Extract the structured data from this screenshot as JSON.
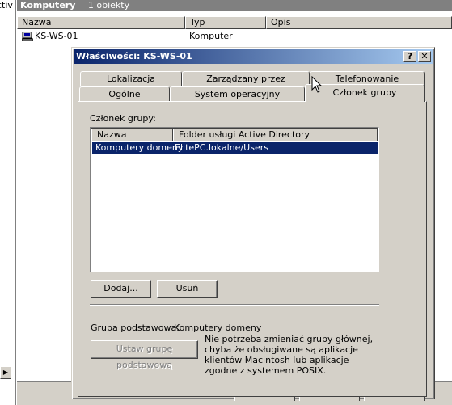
{
  "background": {
    "left_strip_text": "ctiv",
    "pane_title": "Komputery",
    "pane_count": "1 obiekty",
    "columns": [
      "Nazwa",
      "Typ",
      "Opis"
    ],
    "rows": [
      {
        "name": "KS-WS-01",
        "type": "Komputer",
        "icon": "computer-icon"
      }
    ],
    "scroll_arrow": "▶"
  },
  "dialog": {
    "title": "Właściwości: KS-WS-01",
    "help_glyph": "?",
    "close_glyph": "✕",
    "tabs_row1": [
      "Lokalizacja",
      "Zarządzany przez",
      "Telefonowanie"
    ],
    "tabs_row2": [
      "Ogólne",
      "System operacyjny",
      "Członek grupy"
    ],
    "active_tab": "Członek grupy",
    "member_label": "Członek grupy:",
    "list_columns": [
      "Nazwa",
      "Folder usługi Active Directory"
    ],
    "members": [
      {
        "name": "Komputery domeny",
        "folder": "ElitePC.lokalne/Users",
        "selected": true
      }
    ],
    "add_button": "Dodaj...",
    "remove_button": "Usuń",
    "primary_group_label": "Grupa podstawowa:",
    "primary_group_value": "Komputery domeny",
    "set_primary_button": "Ustaw grupę podstawową",
    "note": "Nie potrzeba zmieniać grupy głównej, chyba że obsługiwane są aplikacje klientów Macintosh lub aplikacje zgodne z systemem POSIX."
  },
  "colors": {
    "titlebar_start": "#0a246a",
    "titlebar_end": "#a6caf0",
    "selection": "#0a246a",
    "face": "#d4d0c8"
  }
}
